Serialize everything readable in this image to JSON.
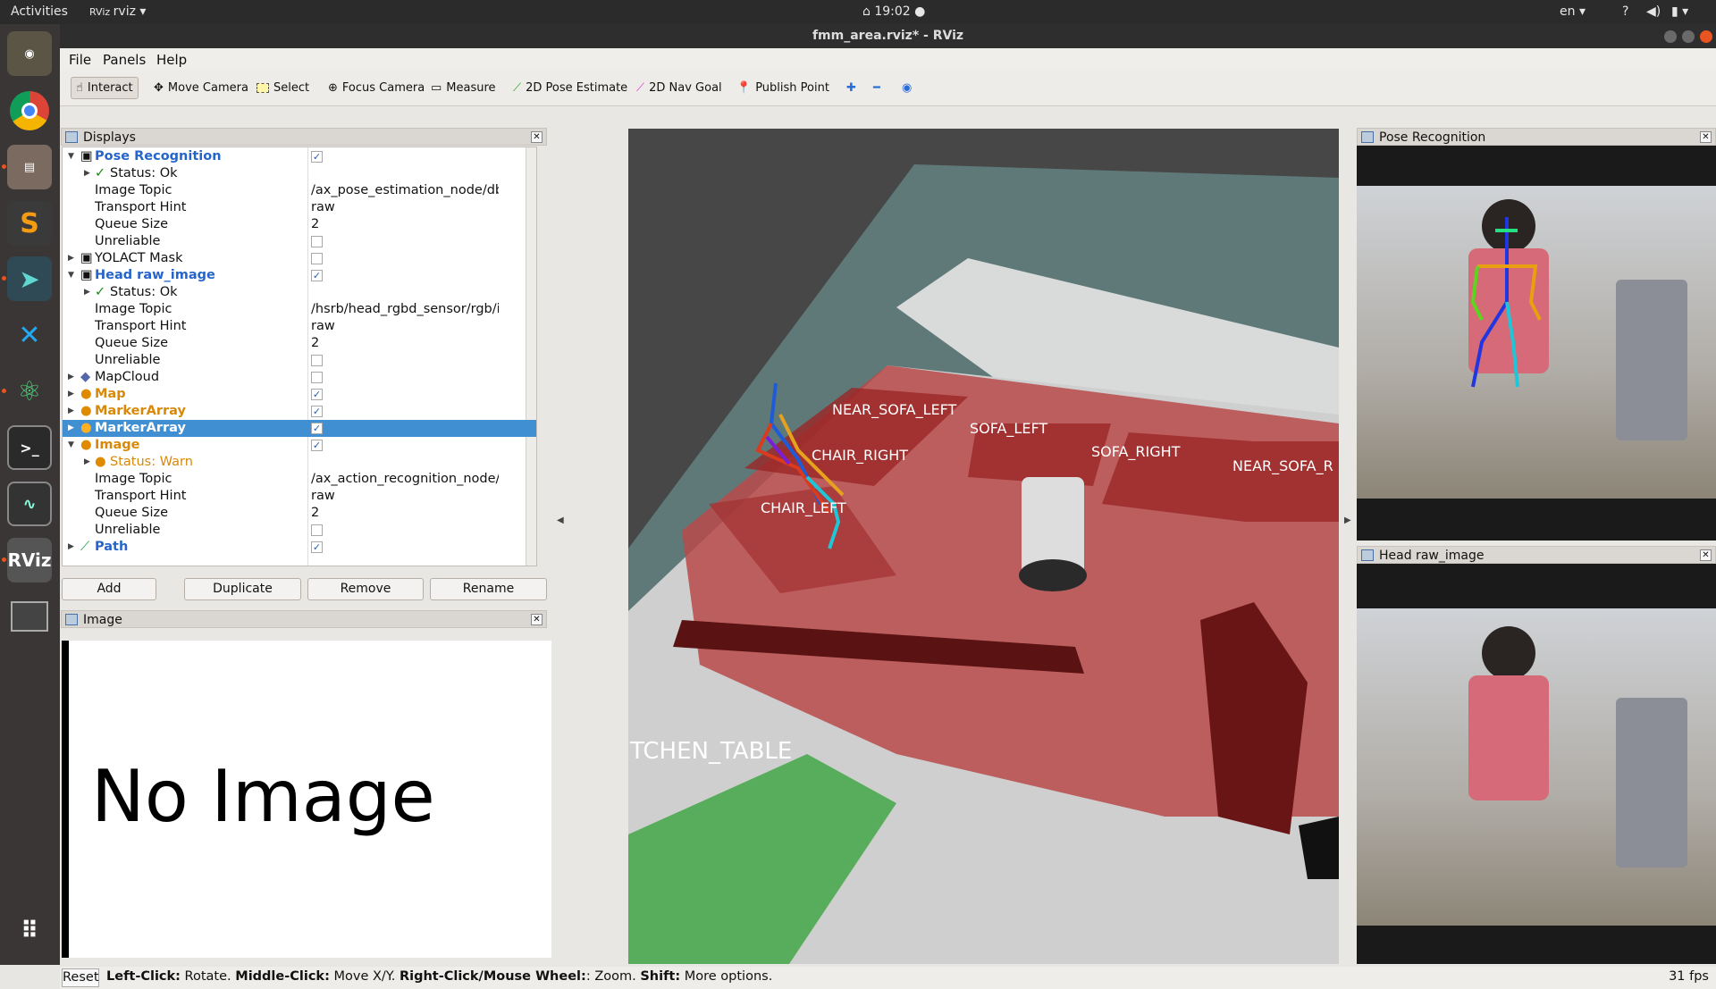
{
  "topbar": {
    "activities": "Activities",
    "app": "rviz",
    "clock": "19:02",
    "lang": "en"
  },
  "window": {
    "title": "fmm_area.rviz* - RViz"
  },
  "menu": [
    "File",
    "Panels",
    "Help"
  ],
  "toolbar": {
    "interact": "Interact",
    "move_camera": "Move Camera",
    "select": "Select",
    "focus_camera": "Focus Camera",
    "measure": "Measure",
    "pose_estimate": "2D Pose Estimate",
    "nav_goal": "2D Nav Goal",
    "publish_point": "Publish Point"
  },
  "displays": {
    "title": "Displays",
    "rows": [
      {
        "label": "Pose Recognition",
        "checked": "✓",
        "style": "blue"
      },
      {
        "label": "Status: Ok"
      },
      {
        "label": "Image Topic",
        "value": "/ax_pose_estimation_node/dbg"
      },
      {
        "label": "Transport Hint",
        "value": "raw"
      },
      {
        "label": "Queue Size",
        "value": "2"
      },
      {
        "label": "Unreliable"
      },
      {
        "label": "YOLACT Mask"
      },
      {
        "label": "Head raw_image",
        "checked": "✓",
        "style": "blue"
      },
      {
        "label": "Status: Ok"
      },
      {
        "label": "Image Topic",
        "value": "/hsrb/head_rgbd_sensor/rgb/imag..."
      },
      {
        "label": "Transport Hint",
        "value": "raw"
      },
      {
        "label": "Queue Size",
        "value": "2"
      },
      {
        "label": "Unreliable"
      },
      {
        "label": "MapCloud"
      },
      {
        "label": "Map",
        "checked": "✓",
        "style": "orange"
      },
      {
        "label": "MarkerArray",
        "checked": "✓",
        "style": "orange"
      },
      {
        "label": "MarkerArray",
        "checked": "✓",
        "style": "sel"
      },
      {
        "label": "Image",
        "checked": "✓",
        "style": "orange"
      },
      {
        "label": "Status: Warn"
      },
      {
        "label": "Image Topic",
        "value": "/ax_action_recognition_node/dbg"
      },
      {
        "label": "Transport Hint",
        "value": "raw"
      },
      {
        "label": "Queue Size",
        "value": "2"
      },
      {
        "label": "Unreliable"
      },
      {
        "label": "Path",
        "checked": "✓",
        "style": "blue"
      }
    ]
  },
  "buttons": {
    "add": "Add",
    "duplicate": "Duplicate",
    "remove": "Remove",
    "rename": "Rename"
  },
  "image_panel": {
    "title": "Image",
    "message": "No Image"
  },
  "scene_labels": {
    "near_sofa_left": "NEAR_SOFA_LEFT",
    "sofa_left": "SOFA_LEFT",
    "sofa_right": "SOFA_RIGHT",
    "near_sofa_r": "NEAR_SOFA_R",
    "chair_right": "CHAIR_RIGHT",
    "chair_left": "CHAIR_LEFT",
    "kitchen_table": "TCHEN_TABLE"
  },
  "right_panels": {
    "pose": "Pose Recognition",
    "head": "Head raw_image"
  },
  "status": {
    "reset": "Reset",
    "lc": "Left-Click:",
    "lc_t": " Rotate. ",
    "mc": "Middle-Click:",
    "mc_t": " Move X/Y. ",
    "rc": "Right-Click/Mouse Wheel:",
    "rc_t": ": Zoom. ",
    "sh": "Shift:",
    "sh_t": " More options.",
    "fps": "31 fps"
  }
}
